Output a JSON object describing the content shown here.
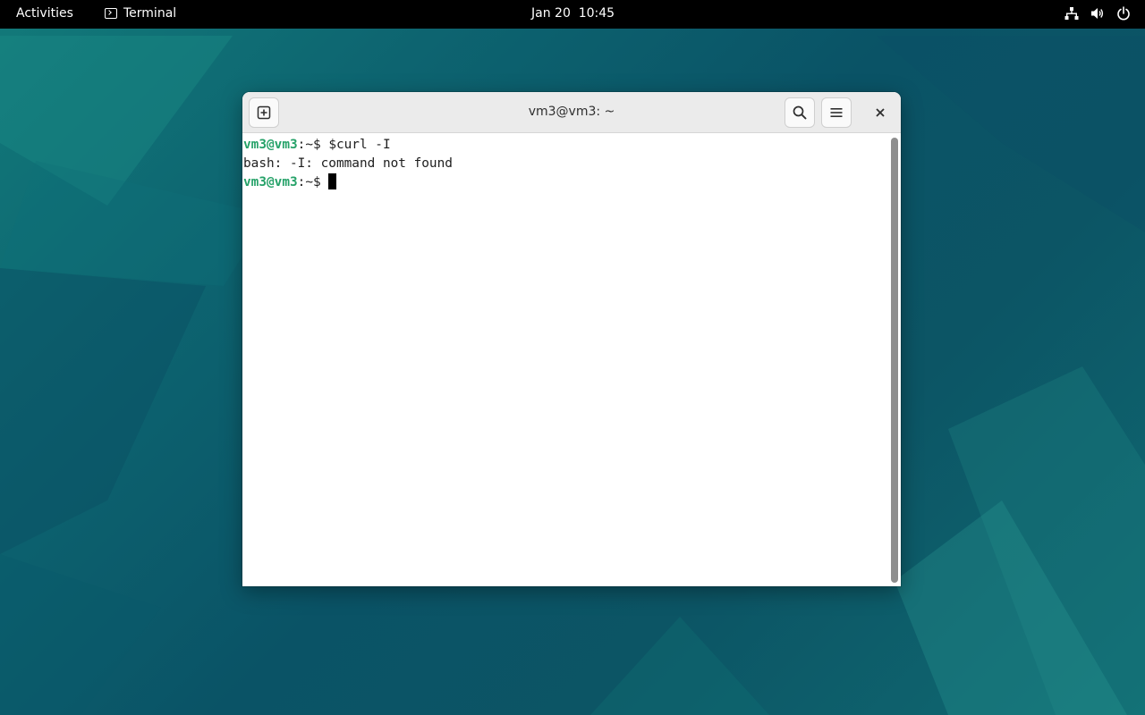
{
  "topbar": {
    "activities_label": "Activities",
    "app_label": "Terminal",
    "clock": "Jan 20  10:45",
    "tray_icons": [
      "network-icon",
      "volume-icon",
      "power-icon"
    ]
  },
  "window": {
    "title": "vm3@vm3: ~",
    "buttons": [
      "new-tab-icon",
      "search-icon",
      "hamburger-menu-icon",
      "close-icon"
    ]
  },
  "terminal": {
    "lines": [
      {
        "user": "vm3@vm3",
        "path": ":~",
        "sym": "$ ",
        "cmd": "$curl -I"
      },
      {
        "output": "bash: -I: command not found"
      },
      {
        "user": "vm3@vm3",
        "path": ":~",
        "sym": "$ ",
        "cmd": ""
      }
    ]
  },
  "colors": {
    "prompt_user": "#26a269",
    "topbar_bg": "#000000",
    "headerbar_bg": "#ebebeb",
    "terminal_bg": "#ffffff"
  }
}
